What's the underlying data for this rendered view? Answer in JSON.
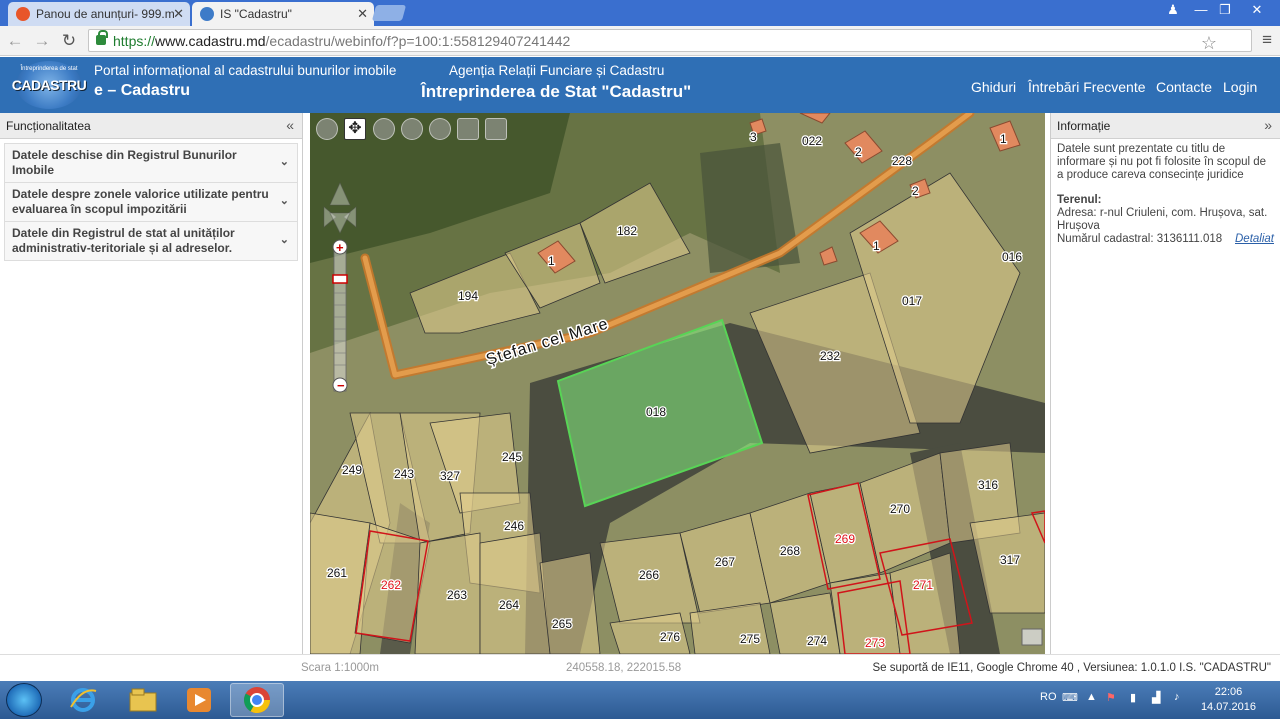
{
  "browser": {
    "tabs": [
      {
        "label": "Panou de anunțuri- 999.m",
        "active": false
      },
      {
        "label": "IS \"Cadastru\"",
        "active": true
      }
    ],
    "url_scheme": "https://",
    "url_host": "www.cadastru.md",
    "url_path": "/ecadastru/webinfo/f?p=100:1:558129407241442"
  },
  "header": {
    "logo_small": "Întreprinderea de stat",
    "logo_text": "CADASTRU",
    "portal_subtitle": "Portal informațional al cadastrului bunurilor imobile",
    "portal_title": "e – Cadastru",
    "agency_subtitle": "Agenția Relații Funciare și Cadastru",
    "agency_title": "Întreprinderea de Stat \"Cadastru\"",
    "nav": [
      "Ghiduri",
      "Întrebări Frecvente",
      "Contacte",
      "Login"
    ]
  },
  "left_panel": {
    "title": "Funcționalitatea",
    "sections": [
      "Datele deschise din Registrul Bunurilor Imobile",
      "Datele despre zonele valorice utilizate pentru evaluarea în scopul impozitării",
      "Datele din Registrul de stat al unităților administrativ-teritoriale și al adreselor."
    ]
  },
  "right_panel": {
    "title": "Informație",
    "disclaimer": "Datele sunt prezentate cu titlu de informare și nu pot fi folosite în scopul de a produce careva consecințe juridice",
    "section_title": "Terenul:",
    "address": "Adresa: r-nul Criuleni, com. Hrușova, sat. Hrușova",
    "cadastral_number": "Numărul cadastral: 3136111.018",
    "details_link": "Detaliat"
  },
  "map": {
    "street_name": "Ștefan cel Mare",
    "parcel_labels": [
      "3",
      "022",
      "2",
      "228",
      "1",
      "2",
      "182",
      "1",
      "1",
      "016",
      "194",
      "017",
      "232",
      "018",
      "249",
      "243",
      "327",
      "245",
      "316",
      "246",
      "270",
      "269",
      "261",
      "262",
      "263",
      "264",
      "265",
      "266",
      "267",
      "268",
      "271",
      "317",
      "276",
      "275",
      "274",
      "273"
    ],
    "red_parcels": [
      "262",
      "269",
      "271",
      "273"
    ],
    "selected_parcel": "018"
  },
  "status": {
    "scale": "Scara 1:1000m",
    "coords": "240558.18, 222015.58",
    "version": "Se suportă de IE11, Google Chrome 40 , Versiunea: 1.0.1.0 I.S. \"CADASTRU\""
  },
  "taskbar": {
    "lang": "RO",
    "time": "22:06",
    "date": "14.07.2016"
  }
}
